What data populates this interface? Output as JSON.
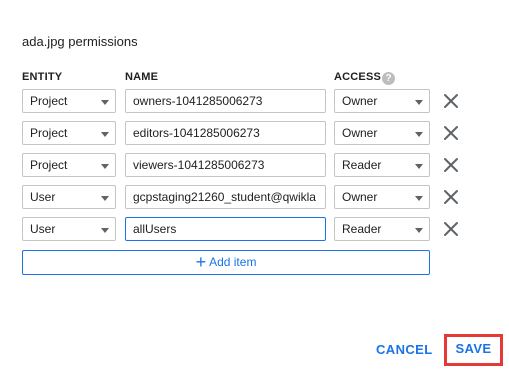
{
  "dialog": {
    "title": "ada.jpg permissions"
  },
  "columns": {
    "entity": "ENTITY",
    "name": "NAME",
    "access": "ACCESS",
    "help_icon": "?"
  },
  "rows": [
    {
      "entity": "Project",
      "name": "owners-1041285006273",
      "access": "Owner"
    },
    {
      "entity": "Project",
      "name": "editors-1041285006273",
      "access": "Owner"
    },
    {
      "entity": "Project",
      "name": "viewers-1041285006273",
      "access": "Reader"
    },
    {
      "entity": "User",
      "name": "gcpstaging21260_student@qwikla",
      "access": "Owner"
    },
    {
      "entity": "User",
      "name": "allUsers",
      "access": "Reader"
    }
  ],
  "add_item": {
    "icon": "+",
    "label": "Add item"
  },
  "actions": {
    "cancel": "CANCEL",
    "save": "SAVE"
  },
  "colors": {
    "accent": "#1a73e8",
    "highlight": "#e53935"
  }
}
